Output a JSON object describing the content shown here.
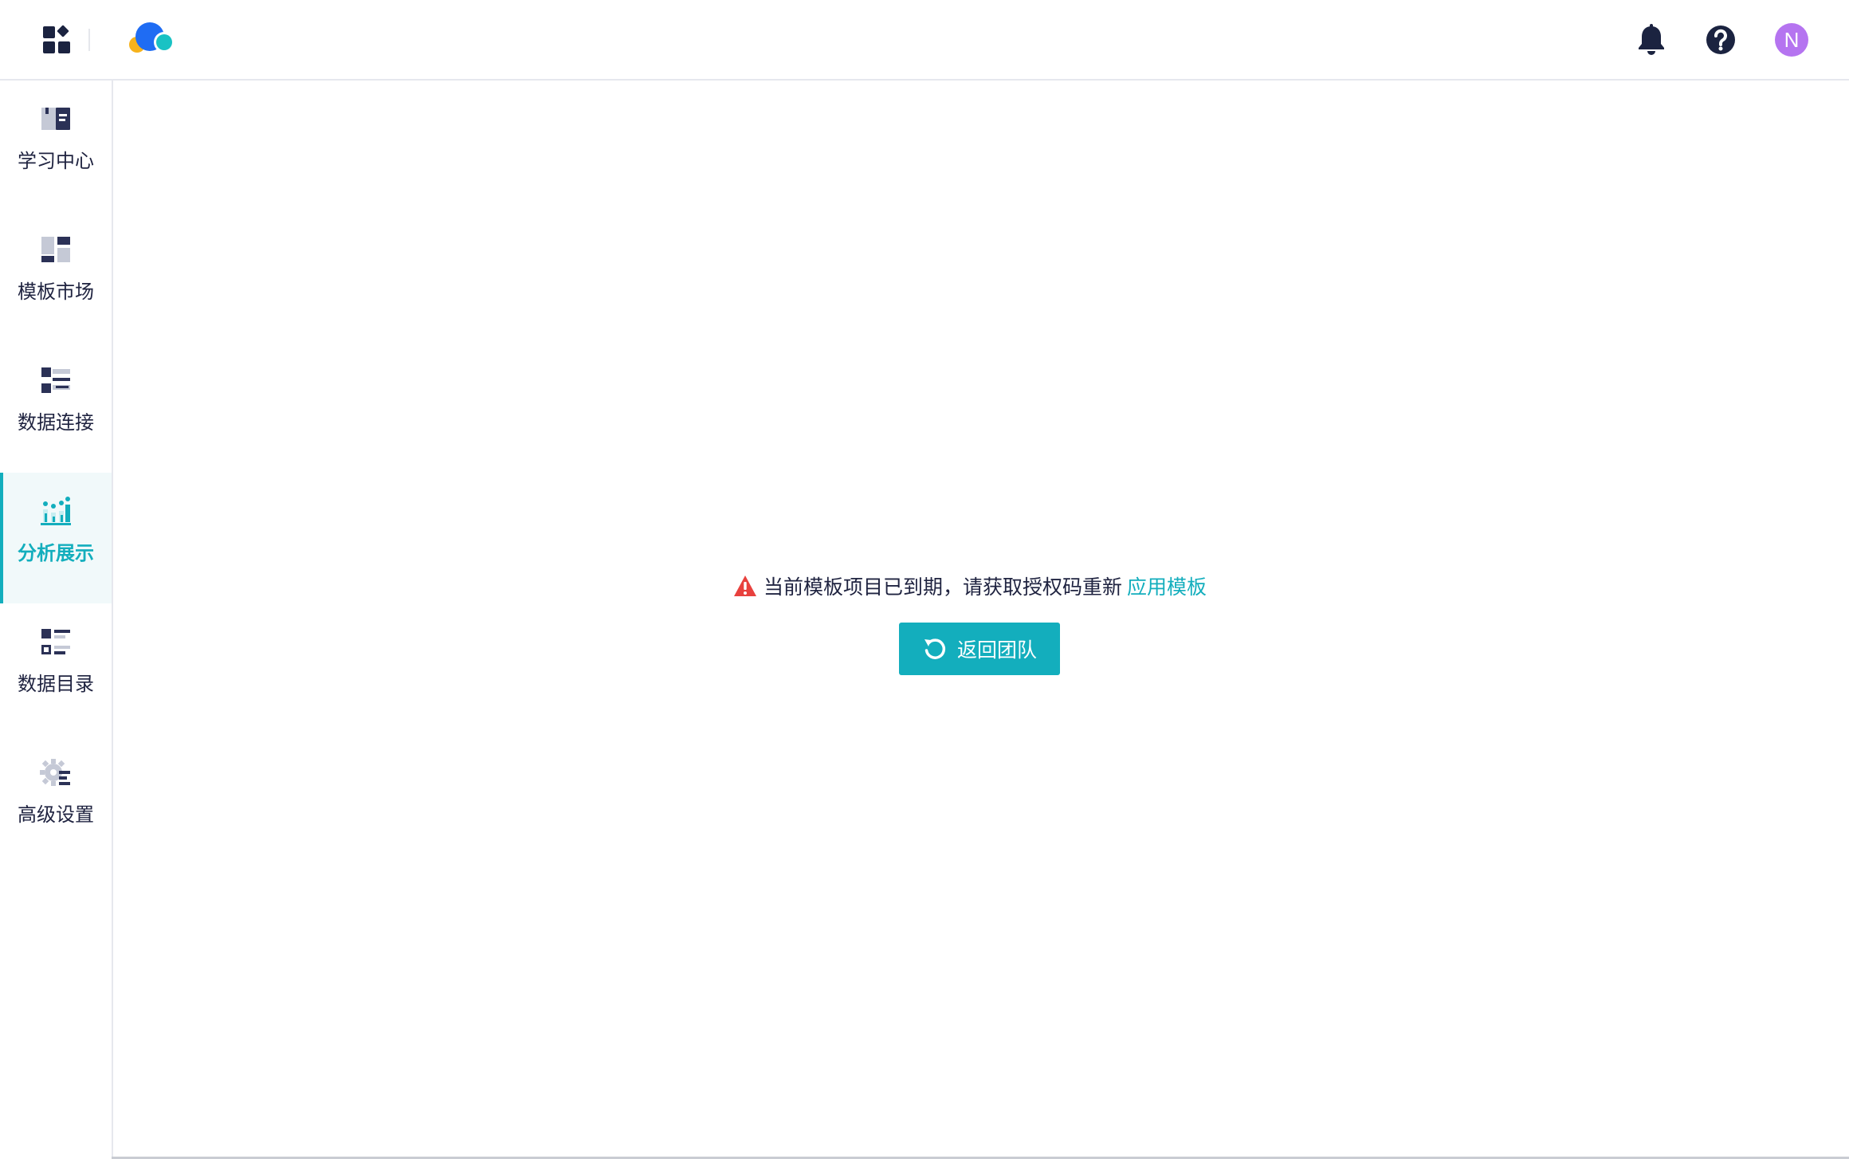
{
  "header": {
    "icons": [
      "apps-grid-icon",
      "cloud-logo",
      "bell-icon",
      "help-icon"
    ],
    "avatar_initial": "N",
    "avatar_color": "#b574f0"
  },
  "sidebar": {
    "active_index": 3,
    "accent_color": "#13aebd",
    "items": [
      {
        "label": "学习中心",
        "icon": "book-icon"
      },
      {
        "label": "模板市场",
        "icon": "template-icon"
      },
      {
        "label": "数据连接",
        "icon": "data-connect-icon"
      },
      {
        "label": "分析展示",
        "icon": "chart-icon"
      },
      {
        "label": "数据目录",
        "icon": "catalog-icon"
      },
      {
        "label": "高级设置",
        "icon": "gear-icon"
      }
    ]
  },
  "main": {
    "notice_text": "当前模板项目已到期，请获取授权码重新",
    "notice_link": "应用模板",
    "warning_color": "#e8413e",
    "back_button_label": "返回团队"
  }
}
